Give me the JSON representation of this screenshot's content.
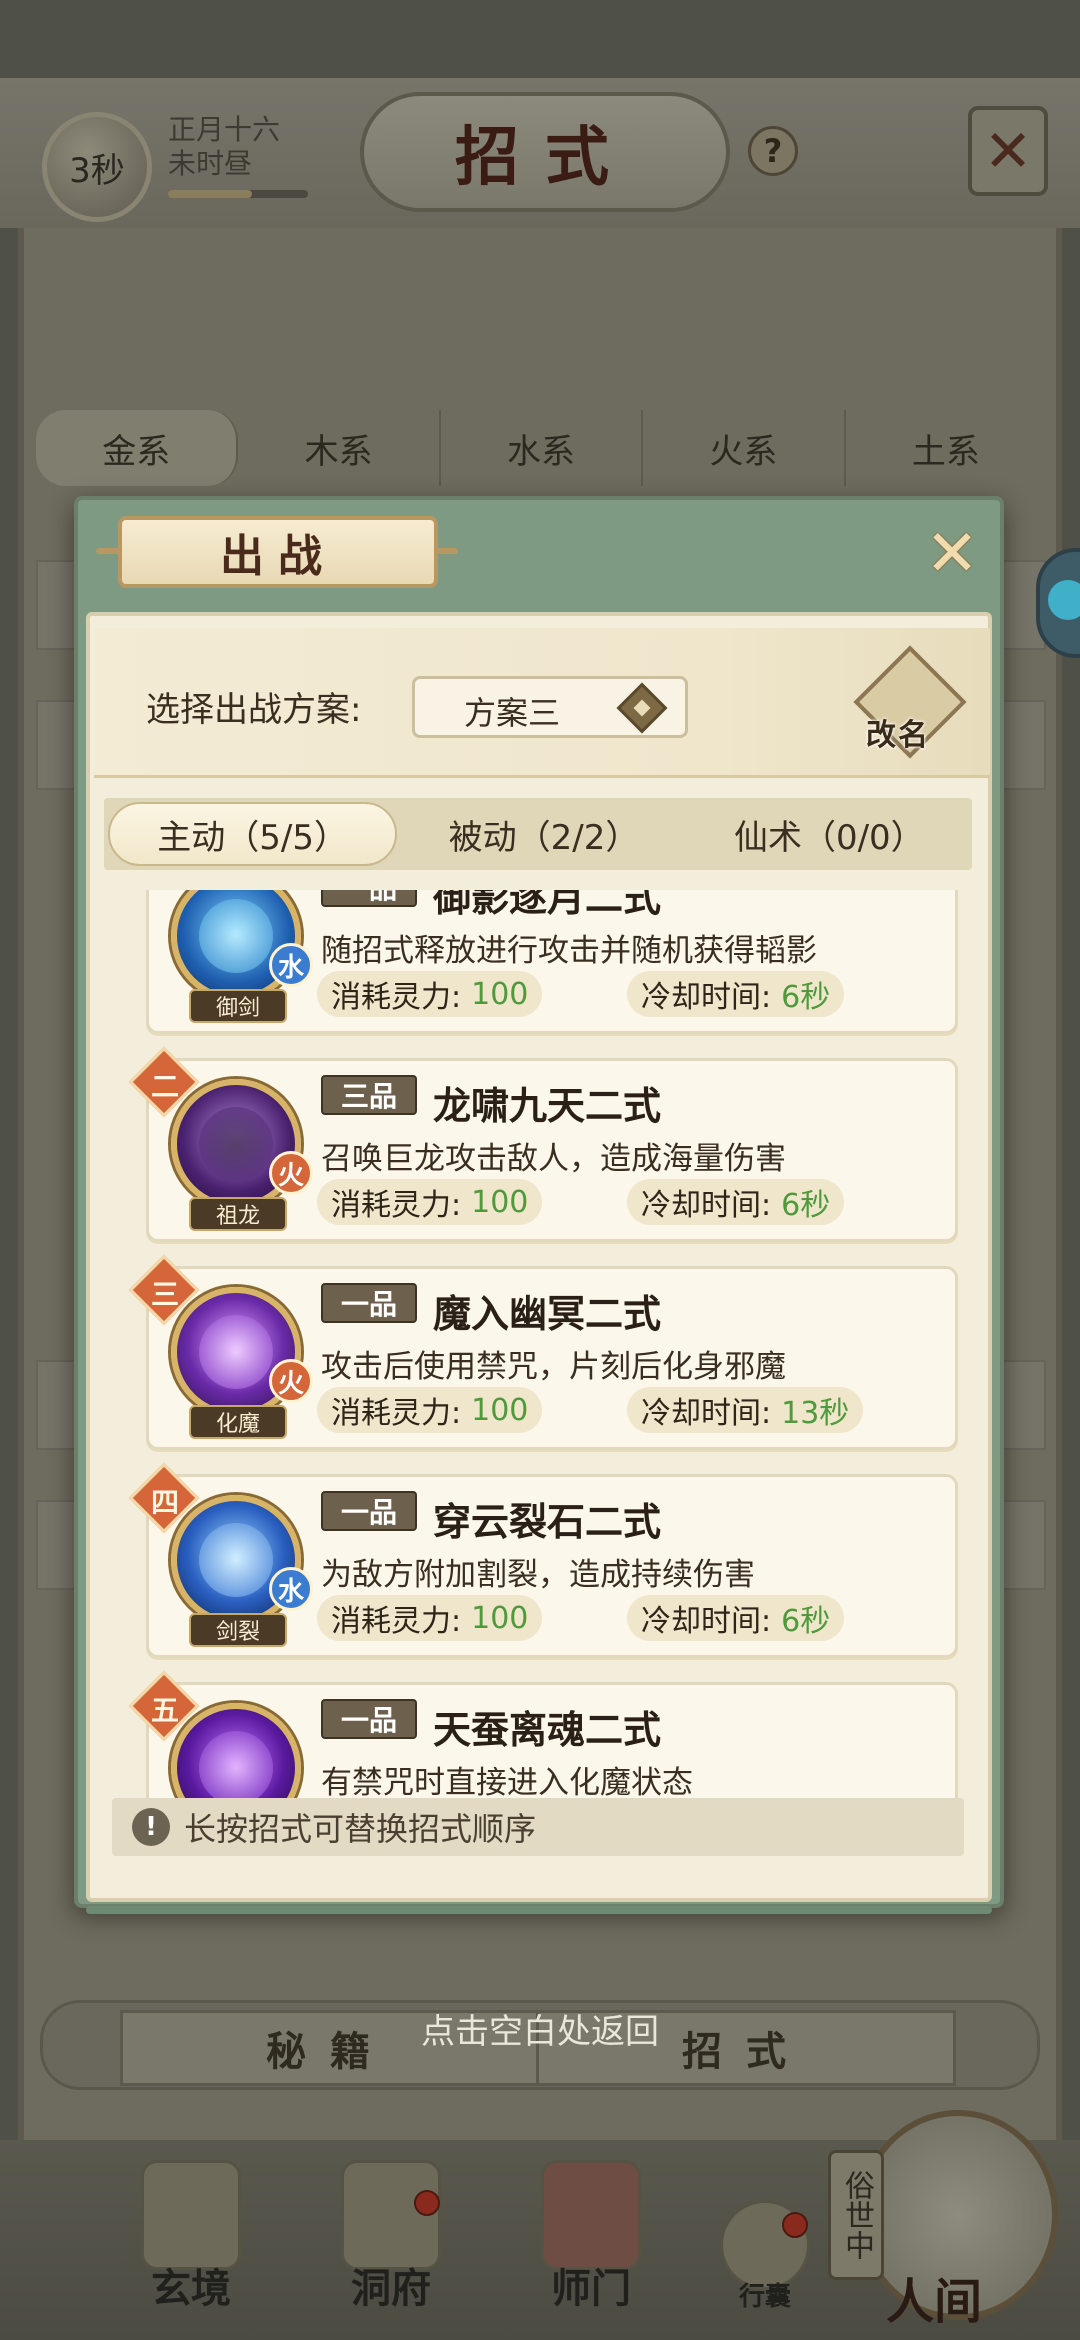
{
  "header": {
    "timer": "3秒",
    "date_line1": "正月十六",
    "date_line2": "未时昼",
    "title": "招式",
    "help": "?"
  },
  "element_tabs": [
    "金系",
    "木系",
    "水系",
    "火系",
    "土系"
  ],
  "dialog": {
    "title": "出战",
    "plan_label": "选择出战方案:",
    "plan_value": "方案三",
    "rename_label": "改名",
    "tabs": [
      "主动（5/5）",
      "被动（2/2）",
      "仙术（0/0）"
    ],
    "cost_label": "消耗灵力:",
    "cooldown_label": "冷却时间:",
    "skills": [
      {
        "rank": "",
        "grade": "一品",
        "name": "御影逐月二式",
        "desc": "随招式释放进行攻击并随机获得韬影",
        "icon_name": "御剑",
        "element": "水",
        "cost": "100",
        "cooldown": "6秒"
      },
      {
        "rank": "二",
        "grade": "三品",
        "name": "龙啸九天二式",
        "desc": "召唤巨龙攻击敌人，造成海量伤害",
        "icon_name": "祖龙",
        "element": "火",
        "cost": "100",
        "cooldown": "6秒"
      },
      {
        "rank": "三",
        "grade": "一品",
        "name": "魔入幽冥二式",
        "desc": "攻击后使用禁咒，片刻后化身邪魔",
        "icon_name": "化魔",
        "element": "火",
        "cost": "100",
        "cooldown": "13秒"
      },
      {
        "rank": "四",
        "grade": "一品",
        "name": "穿云裂石二式",
        "desc": "为敌方附加割裂，造成持续伤害",
        "icon_name": "剑裂",
        "element": "水",
        "cost": "100",
        "cooldown": "6秒"
      },
      {
        "rank": "五",
        "grade": "一品",
        "name": "天蚕离魂二式",
        "desc": "有禁咒时直接进入化魔状态",
        "icon_name": "",
        "element": "",
        "cost": "",
        "cooldown": ""
      }
    ],
    "tip": "长按招式可替换招式顺序"
  },
  "bottom": {
    "return_hint": "点击空白处返回",
    "sub_left": "秘籍",
    "sub_right": "招式",
    "nav": [
      "玄境",
      "洞府",
      "师门",
      "行囊"
    ],
    "world_vertical": "俗世中",
    "world_label": "人间"
  },
  "colors": {
    "water": "#3b7bd0",
    "fire": "#d4663a",
    "stat_green": "#4f9a3a",
    "rank_badge": "#d4663a"
  }
}
